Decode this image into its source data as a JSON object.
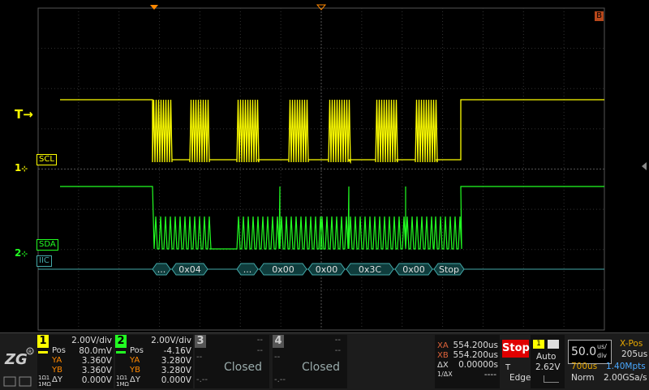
{
  "screen": {
    "trigger_marker": "T",
    "ch1_marker": "1",
    "ch2_marker": "2",
    "b_marker": "B",
    "labels": {
      "scl": "SCL",
      "sda": "SDA",
      "iic": "IIC"
    },
    "decode_packets": [
      "...",
      "0x04",
      "...",
      "0x00",
      "0x00",
      "0x3C",
      "0x00",
      "Stop"
    ]
  },
  "colors": {
    "ch1": "#ffff00",
    "ch2": "#22ff22",
    "iic": "#44aaaa",
    "stop": "#e00000",
    "b_marker": "#b8471b",
    "trigger": "#ff8800"
  },
  "ch1": {
    "number": "1",
    "scale": "2.00V/div",
    "pos_label": "Pos",
    "pos": "80.0mV",
    "ya_label": "YA",
    "ya": "3.360V",
    "yb_label": "YB",
    "yb": "3.360V",
    "coupling": "1Ω1 1MΩ",
    "dy_label": "ΔY",
    "dy": "0.000V"
  },
  "ch2": {
    "number": "2",
    "scale": "2.00V/div",
    "pos_label": "Pos",
    "pos": "-4.16V",
    "ya_label": "YA",
    "ya": "3.280V",
    "yb_label": "YB",
    "yb": "3.280V",
    "coupling": "1Ω1 1MΩ",
    "dy_label": "ΔY",
    "dy": "0.000V"
  },
  "ch3": {
    "number": "3",
    "dash1": "--",
    "dash2": "--",
    "dash3": "--",
    "state": "Closed",
    "dash4": "-.--"
  },
  "ch4": {
    "number": "4",
    "dash1": "--",
    "dash2": "--",
    "dash3": "--",
    "state": "Closed",
    "dash4": "-.--"
  },
  "cursor": {
    "xa_label": "XA",
    "xa": "554.200us",
    "xb_label": "XB",
    "xb": "554.200us",
    "dx_label": "ΔX",
    "dx": "0.00000s",
    "inv_label": "1/ΔX",
    "inv": "----"
  },
  "run": {
    "state": "Stop",
    "trig_src": "1",
    "mode": "Auto",
    "trig_label": "T",
    "trig_level": "2.62V",
    "type": "Edge"
  },
  "timebase": {
    "value": "50.0",
    "unit_top": "us/",
    "unit_bottom": "div",
    "xpos_label": "X-Pos",
    "xpos": "205us",
    "time": "700us",
    "mpts": "1.40Mpts",
    "acq": "Norm",
    "rate": "2.00GSa/s"
  }
}
